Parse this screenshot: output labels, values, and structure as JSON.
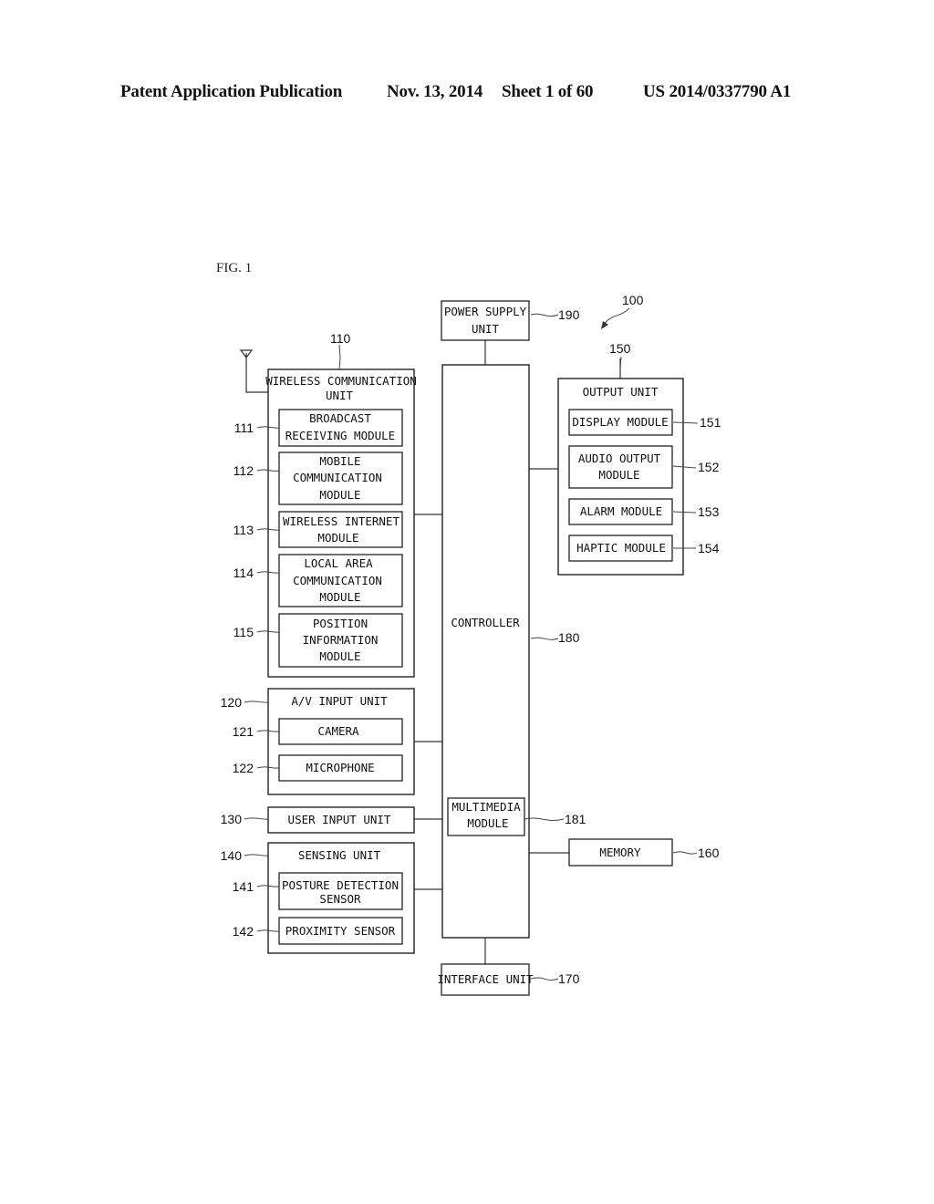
{
  "header": {
    "publication": "Patent Application Publication",
    "date": "Nov. 13, 2014",
    "sheet": "Sheet 1 of 60",
    "number": "US 2014/0337790 A1"
  },
  "figure": {
    "label": "FIG. 1",
    "device_ref": "100",
    "power_supply": {
      "lines": [
        "POWER SUPPLY",
        "UNIT"
      ],
      "ref": "190"
    },
    "controller": {
      "label": "CONTROLLER",
      "ref": "180"
    },
    "multimedia": {
      "lines": [
        "MULTIMEDIA",
        "MODULE"
      ],
      "ref": "181"
    },
    "interface": {
      "label": "INTERFACE UNIT",
      "ref": "170"
    },
    "memory": {
      "label": "MEMORY",
      "ref": "160"
    },
    "wireless": {
      "lines": [
        "WIRELESS COMMUNICATION",
        "UNIT"
      ],
      "ref": "110",
      "modules": [
        {
          "lines": [
            "BROADCAST",
            "RECEIVING MODULE"
          ],
          "ref": "111"
        },
        {
          "lines": [
            "MOBILE",
            "COMMUNICATION",
            "MODULE"
          ],
          "ref": "112"
        },
        {
          "lines": [
            "WIRELESS INTERNET",
            "MODULE"
          ],
          "ref": "113"
        },
        {
          "lines": [
            "LOCAL AREA",
            "COMMUNICATION",
            "MODULE"
          ],
          "ref": "114"
        },
        {
          "lines": [
            "POSITION",
            "INFORMATION",
            "MODULE"
          ],
          "ref": "115"
        }
      ]
    },
    "av_input": {
      "label": "A/V INPUT UNIT",
      "ref": "120",
      "modules": [
        {
          "label": "CAMERA",
          "ref": "121"
        },
        {
          "label": "MICROPHONE",
          "ref": "122"
        }
      ]
    },
    "user_input": {
      "label": "USER INPUT UNIT",
      "ref": "130"
    },
    "sensing": {
      "label": "SENSING UNIT",
      "ref": "140",
      "modules": [
        {
          "lines": [
            "POSTURE DETECTION",
            "SENSOR"
          ],
          "ref": "141"
        },
        {
          "lines": [
            "PROXIMITY SENSOR"
          ],
          "ref": "142"
        }
      ]
    },
    "output": {
      "label": "OUTPUT UNIT",
      "ref": "150",
      "modules": [
        {
          "lines": [
            "DISPLAY MODULE"
          ],
          "ref": "151"
        },
        {
          "lines": [
            "AUDIO OUTPUT",
            "MODULE"
          ],
          "ref": "152"
        },
        {
          "lines": [
            "ALARM MODULE"
          ],
          "ref": "153"
        },
        {
          "lines": [
            "HAPTIC MODULE"
          ],
          "ref": "154"
        }
      ]
    }
  }
}
